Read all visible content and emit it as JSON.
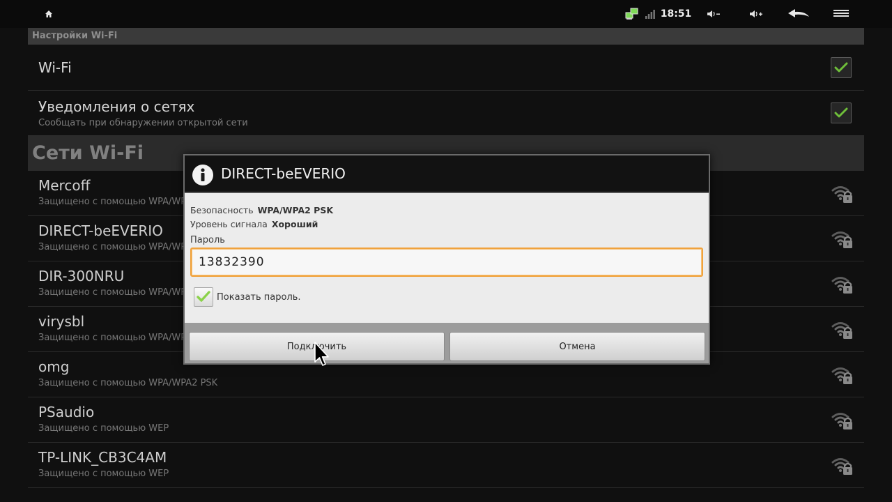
{
  "status_bar": {
    "time": "18:51",
    "icons": [
      "home-icon",
      "network-icon",
      "signal-icon",
      "volume-down-icon",
      "volume-up-icon",
      "back-icon",
      "menu-icon"
    ]
  },
  "header": {
    "title": "Настройки Wi-Fi"
  },
  "prefs": {
    "wifi": {
      "title": "Wi-Fi",
      "checked": true
    },
    "notify": {
      "title": "Уведомления о сетях",
      "summary": "Сообщать при обнаружении открытой сети",
      "checked": true
    }
  },
  "networks_header": "Сети Wi-Fi",
  "networks": [
    {
      "name": "Mercoff",
      "security": "Защищено с помощью WPA/WPA2 PSK"
    },
    {
      "name": "DIRECT-beEVERIO",
      "security": "Защищено с помощью WPA/WPA2 PSK"
    },
    {
      "name": "DIR-300NRU",
      "security": "Защищено с помощью WPA/WPA2 PSK"
    },
    {
      "name": "virysbl",
      "security": "Защищено с помощью WPA/WPA2 PSK"
    },
    {
      "name": "omg",
      "security": "Защищено с помощью WPA/WPA2 PSK"
    },
    {
      "name": "PSaudio",
      "security": "Защищено с помощью WEP"
    },
    {
      "name": "TP-LINK_CB3C4AM",
      "security": "Защищено с помощью WEP"
    }
  ],
  "dialog": {
    "title": "DIRECT-beEVERIO",
    "security_label": "Безопасность",
    "security_value": "WPA/WPA2 PSK",
    "signal_label": "Уровень сигнала",
    "signal_value": "Хороший",
    "password_label": "Пароль",
    "password_value": "13832390",
    "show_password_label": "Показать пароль.",
    "show_password_checked": true,
    "connect_label": "Подключить",
    "cancel_label": "Отмена"
  },
  "colors": {
    "accent_orange": "#f0a23c",
    "check_green": "#8bd24a",
    "background": "#101010"
  }
}
